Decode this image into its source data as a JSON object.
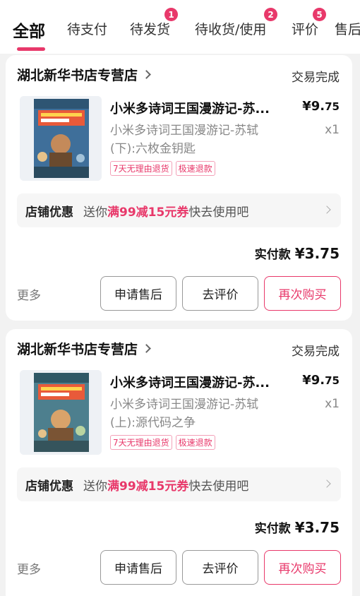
{
  "tabs": [
    {
      "label": "全部",
      "badge": null,
      "active": true
    },
    {
      "label": "待支付",
      "badge": null
    },
    {
      "label": "待发货",
      "badge": "1"
    },
    {
      "label": "待收货/使用",
      "badge": "2"
    },
    {
      "label": "评价",
      "badge": "5"
    },
    {
      "label": "售后",
      "badge": null
    }
  ],
  "orders": [
    {
      "store_name": "湖北新华书店专营店",
      "status": "交易完成",
      "product_title": "小米多诗词王国漫游记-苏...",
      "price_main": "¥9.",
      "price_cents": "75",
      "product_subtitle_line1": "小米多诗词王国漫游记-苏轼",
      "product_subtitle_line2": "(下):六枚金钥匙",
      "quantity": "x1",
      "tags": [
        "7天无理由退货",
        "极速退款"
      ],
      "promo_title": "店铺优惠",
      "promo_prefix": "送你",
      "promo_highlight": "满99减15元券",
      "promo_suffix": "快去使用吧",
      "paid_label": "实付款",
      "paid_value": "¥3.75",
      "more_label": "更多",
      "btn_after_sale": "申请售后",
      "btn_review": "去评价",
      "btn_rebuy": "再次购买"
    },
    {
      "store_name": "湖北新华书店专营店",
      "status": "交易完成",
      "product_title": "小米多诗词王国漫游记-苏...",
      "price_main": "¥9.",
      "price_cents": "75",
      "product_subtitle_line1": "小米多诗词王国漫游记-苏轼",
      "product_subtitle_line2": "(上):源代码之争",
      "quantity": "x1",
      "tags": [
        "7天无理由退货",
        "极速退款"
      ],
      "promo_title": "店铺优惠",
      "promo_prefix": "送你",
      "promo_highlight": "满99减15元券",
      "promo_suffix": "快去使用吧",
      "paid_label": "实付款",
      "paid_value": "¥3.75",
      "more_label": "更多",
      "btn_after_sale": "申请售后",
      "btn_review": "去评价",
      "btn_rebuy": "再次购买"
    }
  ],
  "colors": {
    "accent": "#e8386a",
    "background": "#f2f2f2"
  }
}
